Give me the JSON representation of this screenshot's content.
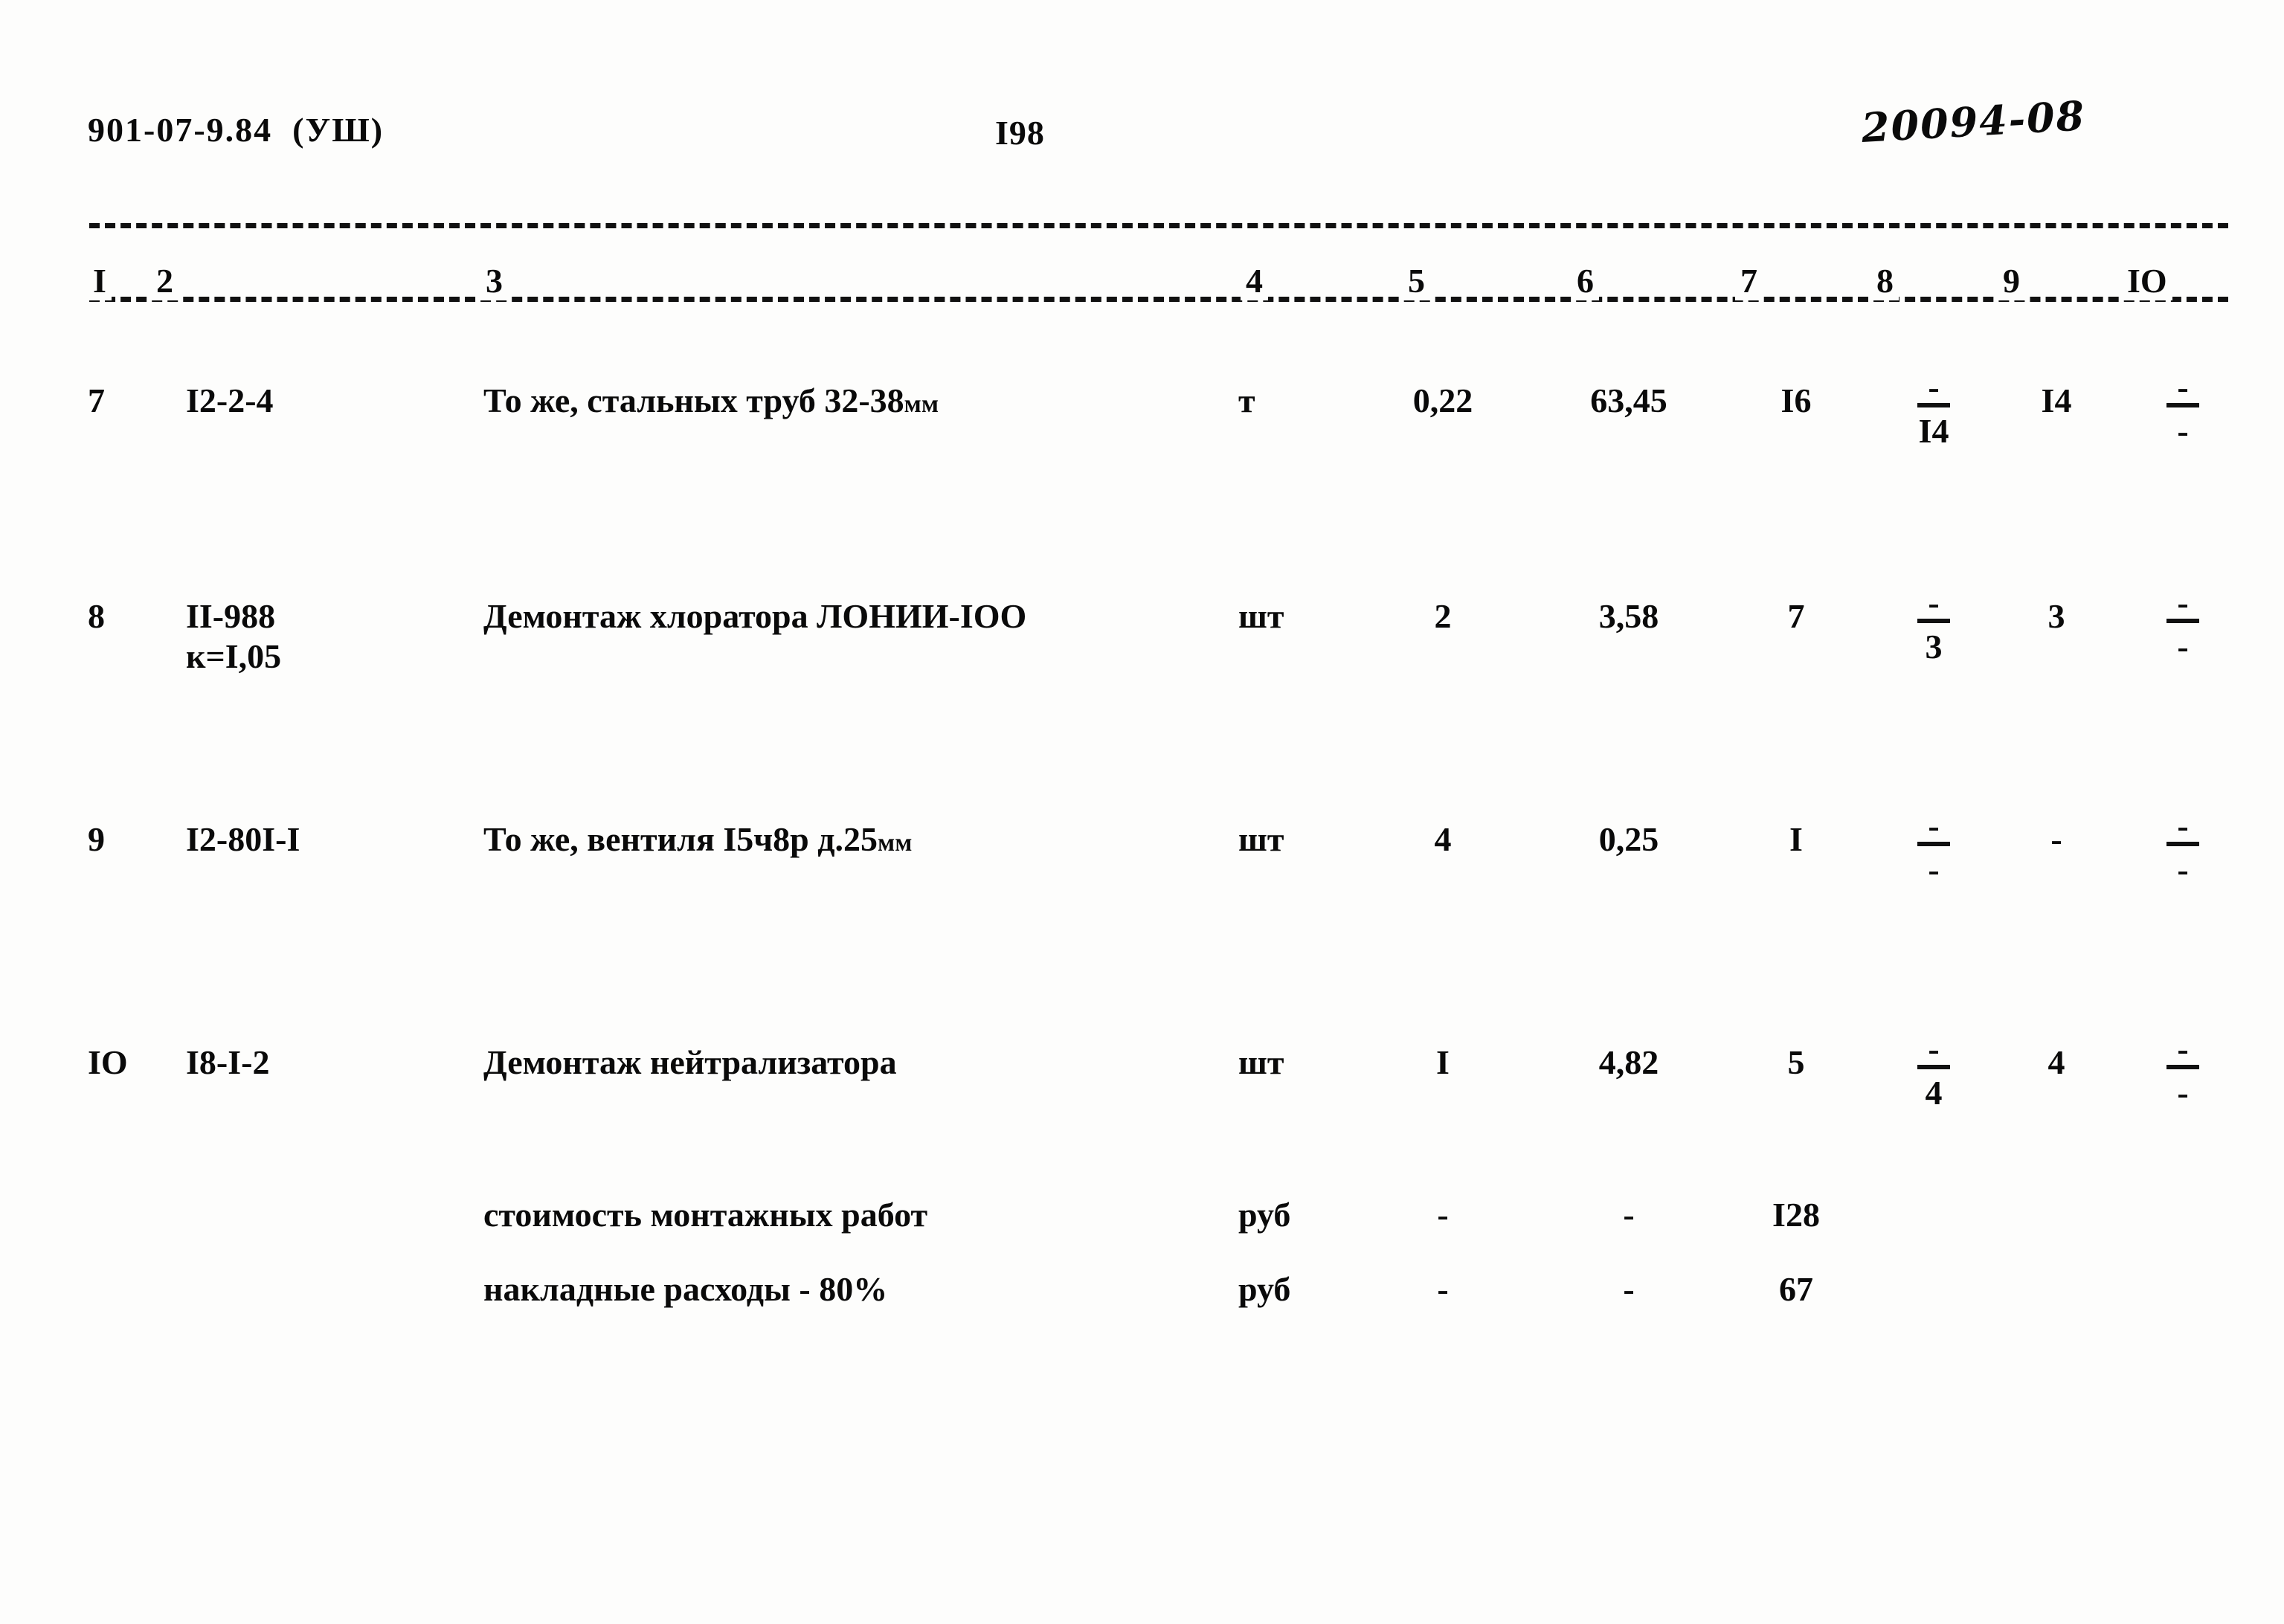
{
  "header": {
    "document_code": "901-07-9.84  (УШ)",
    "page_number": "I98",
    "handwritten_code": "20094-08"
  },
  "table": {
    "column_numbers": [
      "I",
      "2",
      "3",
      "4",
      "5",
      "6",
      "7",
      "8",
      "9",
      "IO"
    ],
    "rows": [
      {
        "num": "7",
        "code": "I2-2-4",
        "subcode": "",
        "description": "То же, стальных труб 32-38",
        "description_suffix": "мм",
        "unit": "т",
        "quantity": "0,22",
        "price": "63,45",
        "sum": "I6",
        "col8_top": "-",
        "col8_bottom": "I4",
        "col9": "I4",
        "col10_top": "-",
        "col10_bottom": "-"
      },
      {
        "num": "8",
        "code": "II-988",
        "subcode": "к=I,05",
        "description": "Демонтаж хлоратора ЛОНИИ-IОО",
        "description_suffix": "",
        "unit": "шт",
        "quantity": "2",
        "price": "3,58",
        "sum": "7",
        "col8_top": "-",
        "col8_bottom": "3",
        "col9": "3",
        "col10_top": "-",
        "col10_bottom": "-"
      },
      {
        "num": "9",
        "code": "I2-80I-I",
        "subcode": "",
        "description": "То же, вентиля I5ч8р д.25",
        "description_suffix": "мм",
        "unit": "шт",
        "quantity": "4",
        "price": "0,25",
        "sum": "I",
        "col8_top": "-",
        "col8_bottom": "-",
        "col9": "-",
        "col10_top": "-",
        "col10_bottom": "-"
      },
      {
        "num": "IO",
        "code": "I8-I-2",
        "subcode": "",
        "description": "Демонтаж нейтрализатора",
        "description_suffix": "",
        "unit": "шт",
        "quantity": "I",
        "price": "4,82",
        "sum": "5",
        "col8_top": "-",
        "col8_bottom": "4",
        "col9": "4",
        "col10_top": "-",
        "col10_bottom": "-"
      }
    ],
    "totals": [
      {
        "description": "стоимость монтажных работ",
        "unit": "руб",
        "quantity": "-",
        "price": "-",
        "sum": "I28"
      },
      {
        "description": "накладные расходы - 80%",
        "unit": "руб",
        "quantity": "-",
        "price": "-",
        "sum": "67"
      }
    ]
  }
}
